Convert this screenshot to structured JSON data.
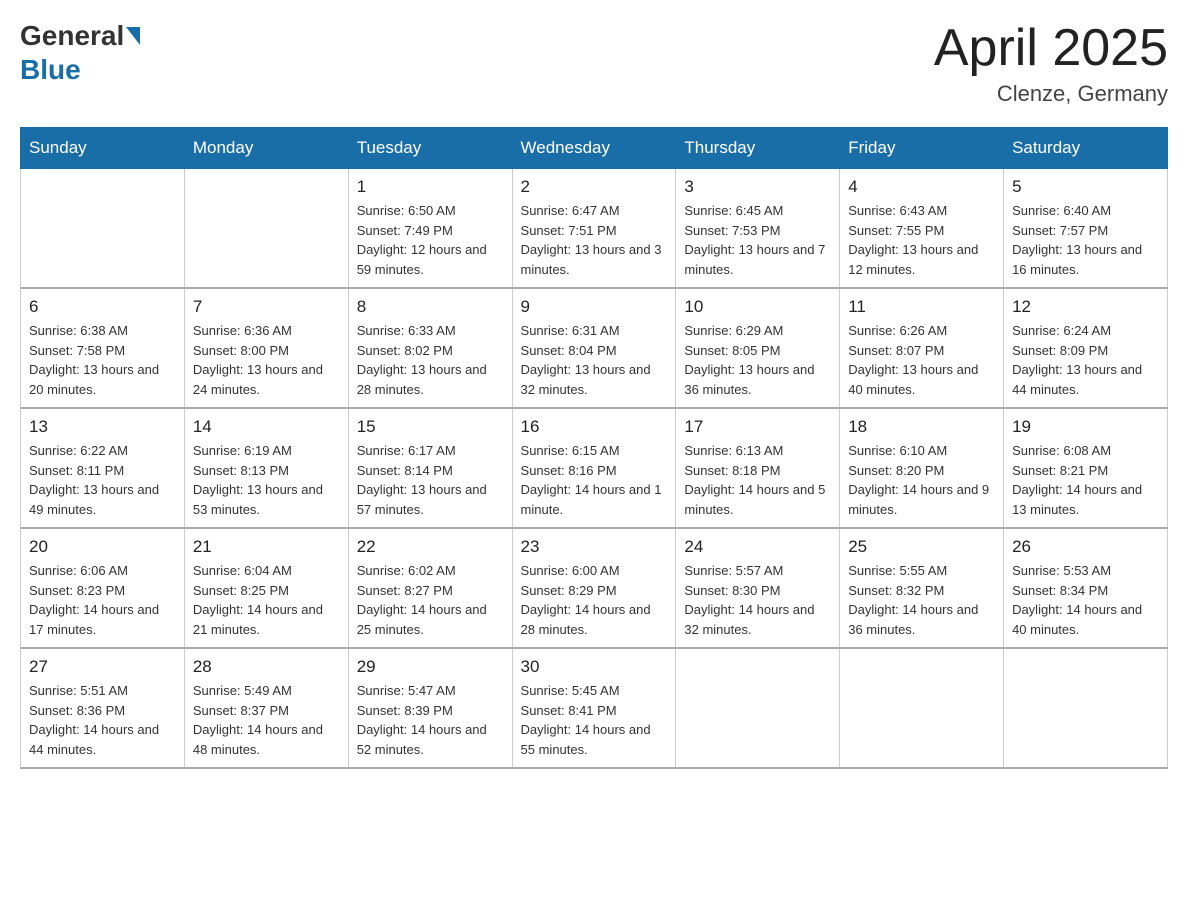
{
  "header": {
    "logo_general": "General",
    "logo_blue": "Blue",
    "title": "April 2025",
    "location": "Clenze, Germany"
  },
  "days_of_week": [
    "Sunday",
    "Monday",
    "Tuesday",
    "Wednesday",
    "Thursday",
    "Friday",
    "Saturday"
  ],
  "weeks": [
    [
      {
        "day": "",
        "sunrise": "",
        "sunset": "",
        "daylight": ""
      },
      {
        "day": "",
        "sunrise": "",
        "sunset": "",
        "daylight": ""
      },
      {
        "day": "1",
        "sunrise": "Sunrise: 6:50 AM",
        "sunset": "Sunset: 7:49 PM",
        "daylight": "Daylight: 12 hours and 59 minutes."
      },
      {
        "day": "2",
        "sunrise": "Sunrise: 6:47 AM",
        "sunset": "Sunset: 7:51 PM",
        "daylight": "Daylight: 13 hours and 3 minutes."
      },
      {
        "day": "3",
        "sunrise": "Sunrise: 6:45 AM",
        "sunset": "Sunset: 7:53 PM",
        "daylight": "Daylight: 13 hours and 7 minutes."
      },
      {
        "day": "4",
        "sunrise": "Sunrise: 6:43 AM",
        "sunset": "Sunset: 7:55 PM",
        "daylight": "Daylight: 13 hours and 12 minutes."
      },
      {
        "day": "5",
        "sunrise": "Sunrise: 6:40 AM",
        "sunset": "Sunset: 7:57 PM",
        "daylight": "Daylight: 13 hours and 16 minutes."
      }
    ],
    [
      {
        "day": "6",
        "sunrise": "Sunrise: 6:38 AM",
        "sunset": "Sunset: 7:58 PM",
        "daylight": "Daylight: 13 hours and 20 minutes."
      },
      {
        "day": "7",
        "sunrise": "Sunrise: 6:36 AM",
        "sunset": "Sunset: 8:00 PM",
        "daylight": "Daylight: 13 hours and 24 minutes."
      },
      {
        "day": "8",
        "sunrise": "Sunrise: 6:33 AM",
        "sunset": "Sunset: 8:02 PM",
        "daylight": "Daylight: 13 hours and 28 minutes."
      },
      {
        "day": "9",
        "sunrise": "Sunrise: 6:31 AM",
        "sunset": "Sunset: 8:04 PM",
        "daylight": "Daylight: 13 hours and 32 minutes."
      },
      {
        "day": "10",
        "sunrise": "Sunrise: 6:29 AM",
        "sunset": "Sunset: 8:05 PM",
        "daylight": "Daylight: 13 hours and 36 minutes."
      },
      {
        "day": "11",
        "sunrise": "Sunrise: 6:26 AM",
        "sunset": "Sunset: 8:07 PM",
        "daylight": "Daylight: 13 hours and 40 minutes."
      },
      {
        "day": "12",
        "sunrise": "Sunrise: 6:24 AM",
        "sunset": "Sunset: 8:09 PM",
        "daylight": "Daylight: 13 hours and 44 minutes."
      }
    ],
    [
      {
        "day": "13",
        "sunrise": "Sunrise: 6:22 AM",
        "sunset": "Sunset: 8:11 PM",
        "daylight": "Daylight: 13 hours and 49 minutes."
      },
      {
        "day": "14",
        "sunrise": "Sunrise: 6:19 AM",
        "sunset": "Sunset: 8:13 PM",
        "daylight": "Daylight: 13 hours and 53 minutes."
      },
      {
        "day": "15",
        "sunrise": "Sunrise: 6:17 AM",
        "sunset": "Sunset: 8:14 PM",
        "daylight": "Daylight: 13 hours and 57 minutes."
      },
      {
        "day": "16",
        "sunrise": "Sunrise: 6:15 AM",
        "sunset": "Sunset: 8:16 PM",
        "daylight": "Daylight: 14 hours and 1 minute."
      },
      {
        "day": "17",
        "sunrise": "Sunrise: 6:13 AM",
        "sunset": "Sunset: 8:18 PM",
        "daylight": "Daylight: 14 hours and 5 minutes."
      },
      {
        "day": "18",
        "sunrise": "Sunrise: 6:10 AM",
        "sunset": "Sunset: 8:20 PM",
        "daylight": "Daylight: 14 hours and 9 minutes."
      },
      {
        "day": "19",
        "sunrise": "Sunrise: 6:08 AM",
        "sunset": "Sunset: 8:21 PM",
        "daylight": "Daylight: 14 hours and 13 minutes."
      }
    ],
    [
      {
        "day": "20",
        "sunrise": "Sunrise: 6:06 AM",
        "sunset": "Sunset: 8:23 PM",
        "daylight": "Daylight: 14 hours and 17 minutes."
      },
      {
        "day": "21",
        "sunrise": "Sunrise: 6:04 AM",
        "sunset": "Sunset: 8:25 PM",
        "daylight": "Daylight: 14 hours and 21 minutes."
      },
      {
        "day": "22",
        "sunrise": "Sunrise: 6:02 AM",
        "sunset": "Sunset: 8:27 PM",
        "daylight": "Daylight: 14 hours and 25 minutes."
      },
      {
        "day": "23",
        "sunrise": "Sunrise: 6:00 AM",
        "sunset": "Sunset: 8:29 PM",
        "daylight": "Daylight: 14 hours and 28 minutes."
      },
      {
        "day": "24",
        "sunrise": "Sunrise: 5:57 AM",
        "sunset": "Sunset: 8:30 PM",
        "daylight": "Daylight: 14 hours and 32 minutes."
      },
      {
        "day": "25",
        "sunrise": "Sunrise: 5:55 AM",
        "sunset": "Sunset: 8:32 PM",
        "daylight": "Daylight: 14 hours and 36 minutes."
      },
      {
        "day": "26",
        "sunrise": "Sunrise: 5:53 AM",
        "sunset": "Sunset: 8:34 PM",
        "daylight": "Daylight: 14 hours and 40 minutes."
      }
    ],
    [
      {
        "day": "27",
        "sunrise": "Sunrise: 5:51 AM",
        "sunset": "Sunset: 8:36 PM",
        "daylight": "Daylight: 14 hours and 44 minutes."
      },
      {
        "day": "28",
        "sunrise": "Sunrise: 5:49 AM",
        "sunset": "Sunset: 8:37 PM",
        "daylight": "Daylight: 14 hours and 48 minutes."
      },
      {
        "day": "29",
        "sunrise": "Sunrise: 5:47 AM",
        "sunset": "Sunset: 8:39 PM",
        "daylight": "Daylight: 14 hours and 52 minutes."
      },
      {
        "day": "30",
        "sunrise": "Sunrise: 5:45 AM",
        "sunset": "Sunset: 8:41 PM",
        "daylight": "Daylight: 14 hours and 55 minutes."
      },
      {
        "day": "",
        "sunrise": "",
        "sunset": "",
        "daylight": ""
      },
      {
        "day": "",
        "sunrise": "",
        "sunset": "",
        "daylight": ""
      },
      {
        "day": "",
        "sunrise": "",
        "sunset": "",
        "daylight": ""
      }
    ]
  ]
}
